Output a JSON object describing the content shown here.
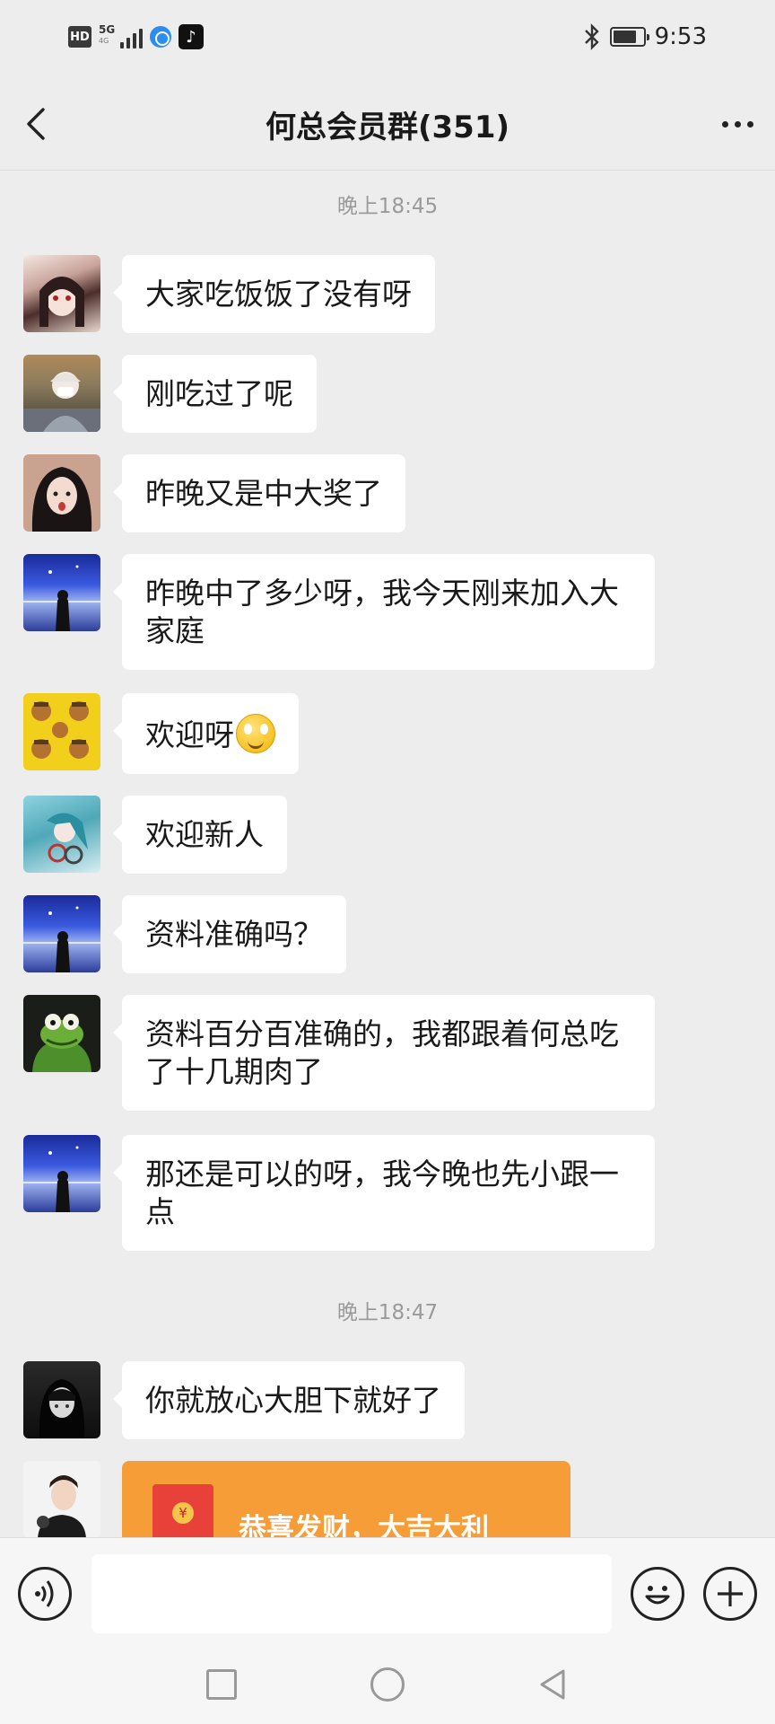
{
  "status_bar": {
    "hd": "HD",
    "network": "5G",
    "network_sub": "4G",
    "time": "9:53"
  },
  "header": {
    "title": "何总会员群(351)",
    "back_icon": "chevron-left-icon",
    "more_icon": "more-dots-icon"
  },
  "chat": {
    "time_1": "晚上18:45",
    "time_2": "晚上18:47",
    "messages": [
      {
        "text": "大家吃饭饭了没有呀"
      },
      {
        "text": "刚吃过了呢"
      },
      {
        "text": "昨晚又是中大奖了"
      },
      {
        "text": "昨晚中了多少呀，我今天刚来加入大家庭"
      },
      {
        "text": "欢迎呀",
        "emoji": "smiley-emoji"
      },
      {
        "text": "欢迎新人"
      },
      {
        "text": "资料准确吗？"
      },
      {
        "text": "资料百分百准确的，我都跟着何总吃了十几期肉了"
      },
      {
        "text": "那还是可以的呀，我今晚也先小跟一点"
      },
      {
        "text": "你就放心大胆下就好了"
      }
    ],
    "red_packet": {
      "text": "恭喜发财，大吉大利",
      "color": "#f79d38"
    }
  },
  "input_bar": {
    "voice_icon": "voice-icon",
    "emoji_icon": "emoji-icon",
    "plus_icon": "plus-icon",
    "value": ""
  },
  "colors": {
    "background": "#ededed",
    "bubble": "#ffffff",
    "timestamp": "#9a9a9a"
  }
}
